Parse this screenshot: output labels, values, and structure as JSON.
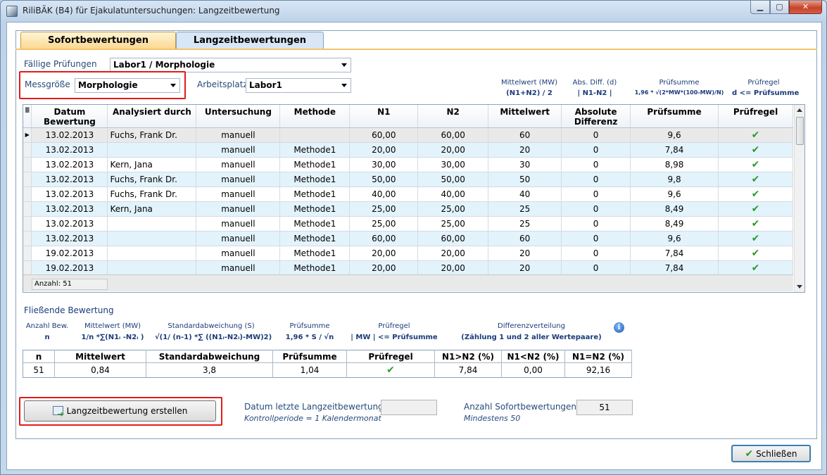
{
  "window": {
    "title": "RiliBÄK (B4) für Ejakulatuntersuchungen: Langzeitbewertung",
    "min": "▁",
    "max": "▢",
    "close": "✕"
  },
  "tabs": [
    "Sofortbewertungen",
    "Langzeitbewertungen"
  ],
  "filters": {
    "faellige_label": "Fällige Prüfungen",
    "faellige_value": "Labor1 / Morphologie",
    "messgroesse_label": "Messgröße",
    "messgroesse_value": "Morphologie",
    "arbeitsplatz_label": "Arbeitsplatz",
    "arbeitsplatz_value": "Labor1"
  },
  "formula_headers": {
    "mw_title": "Mittelwert (MW)",
    "mw_formula": "(N1+N2) / 2",
    "diff_title": "Abs. Diff. (d)",
    "diff_formula": "| N1-N2 |",
    "ps_title": "Prüfsumme",
    "ps_formula": "1,96 * √(2*MW*(100-MW)/N)",
    "pr_title": "Prüfregel",
    "pr_formula": "d <= Prüfsumme"
  },
  "grid": {
    "columns": [
      "Datum Bewertung",
      "Analysiert durch",
      "Untersuchung",
      "Methode",
      "N1",
      "N2",
      "Mittelwert",
      "Absolute Differenz",
      "Prüfsumme",
      "Prüfregel"
    ],
    "rows": [
      [
        "13.02.2013",
        "Fuchs, Frank Dr.",
        "manuell",
        "",
        "60,00",
        "60,00",
        "60",
        "0",
        "9,6",
        "✔"
      ],
      [
        "13.02.2013",
        "",
        "manuell",
        "Methode1",
        "20,00",
        "20,00",
        "20",
        "0",
        "7,84",
        "✔"
      ],
      [
        "13.02.2013",
        "Kern, Jana",
        "manuell",
        "Methode1",
        "30,00",
        "30,00",
        "30",
        "0",
        "8,98",
        "✔"
      ],
      [
        "13.02.2013",
        "Fuchs, Frank Dr.",
        "manuell",
        "Methode1",
        "50,00",
        "50,00",
        "50",
        "0",
        "9,8",
        "✔"
      ],
      [
        "13.02.2013",
        "Fuchs, Frank Dr.",
        "manuell",
        "Methode1",
        "40,00",
        "40,00",
        "40",
        "0",
        "9,6",
        "✔"
      ],
      [
        "13.02.2013",
        "Kern, Jana",
        "manuell",
        "Methode1",
        "25,00",
        "25,00",
        "25",
        "0",
        "8,49",
        "✔"
      ],
      [
        "13.02.2013",
        "",
        "manuell",
        "Methode1",
        "25,00",
        "25,00",
        "25",
        "0",
        "8,49",
        "✔"
      ],
      [
        "13.02.2013",
        "",
        "manuell",
        "Methode1",
        "60,00",
        "60,00",
        "60",
        "0",
        "9,6",
        "✔"
      ],
      [
        "19.02.2013",
        "",
        "manuell",
        "Methode1",
        "20,00",
        "20,00",
        "20",
        "0",
        "7,84",
        "✔"
      ],
      [
        "19.02.2013",
        "",
        "manuell",
        "Methode1",
        "20,00",
        "20,00",
        "20",
        "0",
        "7,84",
        "✔"
      ]
    ],
    "footer": "Anzahl: 51"
  },
  "fliessend": {
    "section_title": "Fließende Bewertung",
    "h_anzahl": "Anzahl Bew.",
    "f_anzahl": "n",
    "h_mw": "Mittelwert (MW)",
    "f_mw": "1/n *∑(N1ᵢ -N2ᵢ )",
    "h_sd": "Standardabweichung (S)",
    "f_sd": "√(1/ (n-1) *∑ ((N1ᵢ-N2ᵢ)-MW)2)",
    "h_ps": "Prüfsumme",
    "f_ps": "1,96 * S / √n",
    "h_pr": "Prüfregel",
    "f_pr": "| MW | <= Prüfsumme",
    "h_dv": "Differenzverteilung",
    "f_dv": "(Zählung 1 und 2 aller Wertepaare)",
    "columns": [
      "n",
      "Mittelwert",
      "Standardabweichung",
      "Prüfsumme",
      "Prüfregel",
      "N1>N2 (%)",
      "N1<N2 (%)",
      "N1=N2 (%)"
    ],
    "values": [
      "51",
      "0,84",
      "3,8",
      "1,04",
      "✔",
      "7,84",
      "0,00",
      "92,16"
    ]
  },
  "bottom": {
    "create_button": "Langzeitbewertung erstellen",
    "datum_label": "Datum letzte Langzeitbewertung",
    "datum_sub": "Kontrollperiode = 1 Kalendermonat",
    "datum_value": "",
    "anzahl_label": "Anzahl Sofortbewertungen",
    "anzahl_sub": "Mindestens 50",
    "anzahl_value": "51",
    "close_button": "Schließen"
  }
}
